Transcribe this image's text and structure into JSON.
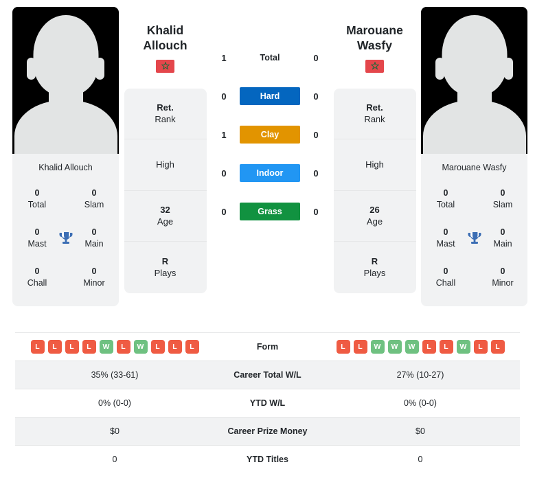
{
  "players": {
    "left": {
      "first_name": "Khalid",
      "last_name": "Allouch",
      "full_name": "Khalid Allouch",
      "country": "Morocco",
      "flag_icon": "morocco-flag-icon",
      "titles": [
        {
          "value": "0",
          "label": "Total"
        },
        {
          "value": "0",
          "label": "Slam"
        },
        {
          "value": "0",
          "label": "Mast"
        },
        {
          "value": "0",
          "label": "Main"
        },
        {
          "value": "0",
          "label": "Chall"
        },
        {
          "value": "0",
          "label": "Minor"
        }
      ],
      "info": [
        {
          "value": "Ret.",
          "label": "Rank"
        },
        {
          "value": "",
          "label": "High"
        },
        {
          "value": "32",
          "label": "Age"
        },
        {
          "value": "R",
          "label": "Plays"
        }
      ],
      "form": [
        "L",
        "L",
        "L",
        "L",
        "W",
        "L",
        "W",
        "L",
        "L",
        "L"
      ],
      "career_total_wl": "35% (33-61)",
      "ytd_wl": "0% (0-0)",
      "career_prize_money": "$0",
      "ytd_titles": "0"
    },
    "right": {
      "first_name": "Marouane",
      "last_name": "Wasfy",
      "full_name": "Marouane Wasfy",
      "country": "Morocco",
      "flag_icon": "morocco-flag-icon",
      "titles": [
        {
          "value": "0",
          "label": "Total"
        },
        {
          "value": "0",
          "label": "Slam"
        },
        {
          "value": "0",
          "label": "Mast"
        },
        {
          "value": "0",
          "label": "Main"
        },
        {
          "value": "0",
          "label": "Chall"
        },
        {
          "value": "0",
          "label": "Minor"
        }
      ],
      "info": [
        {
          "value": "Ret.",
          "label": "Rank"
        },
        {
          "value": "",
          "label": "High"
        },
        {
          "value": "26",
          "label": "Age"
        },
        {
          "value": "R",
          "label": "Plays"
        }
      ],
      "form": [
        "L",
        "L",
        "W",
        "W",
        "W",
        "L",
        "L",
        "W",
        "L",
        "L"
      ],
      "career_total_wl": "27% (10-27)",
      "ytd_wl": "0% (0-0)",
      "career_prize_money": "$0",
      "ytd_titles": "0"
    }
  },
  "head_to_head": [
    {
      "label": "Total",
      "left": "1",
      "right": "0",
      "style": "plain",
      "color": ""
    },
    {
      "label": "Hard",
      "left": "0",
      "right": "0",
      "style": "badge",
      "color": "#0466bf"
    },
    {
      "label": "Clay",
      "left": "1",
      "right": "0",
      "style": "badge",
      "color": "#e29400"
    },
    {
      "label": "Indoor",
      "left": "0",
      "right": "0",
      "style": "badge",
      "color": "#2196f3"
    },
    {
      "label": "Grass",
      "left": "0",
      "right": "0",
      "style": "badge",
      "color": "#119240"
    }
  ],
  "comparison_rows": [
    {
      "label": "Form",
      "left": "",
      "right": "",
      "type": "form"
    },
    {
      "label": "Career Total W/L",
      "left": "35% (33-61)",
      "right": "27% (10-27)",
      "type": "text"
    },
    {
      "label": "YTD W/L",
      "left": "0% (0-0)",
      "right": "0% (0-0)",
      "type": "text"
    },
    {
      "label": "Career Prize Money",
      "left": "$0",
      "right": "$0",
      "type": "text"
    },
    {
      "label": "YTD Titles",
      "left": "0",
      "right": "0",
      "type": "text"
    }
  ],
  "colors": {
    "hard": "#0466bf",
    "clay": "#e29400",
    "indoor": "#2196f3",
    "grass": "#119240",
    "win": "#6fc181",
    "loss": "#ef5b43",
    "trophy": "#3c6eb4",
    "panel": "#f1f2f3"
  }
}
